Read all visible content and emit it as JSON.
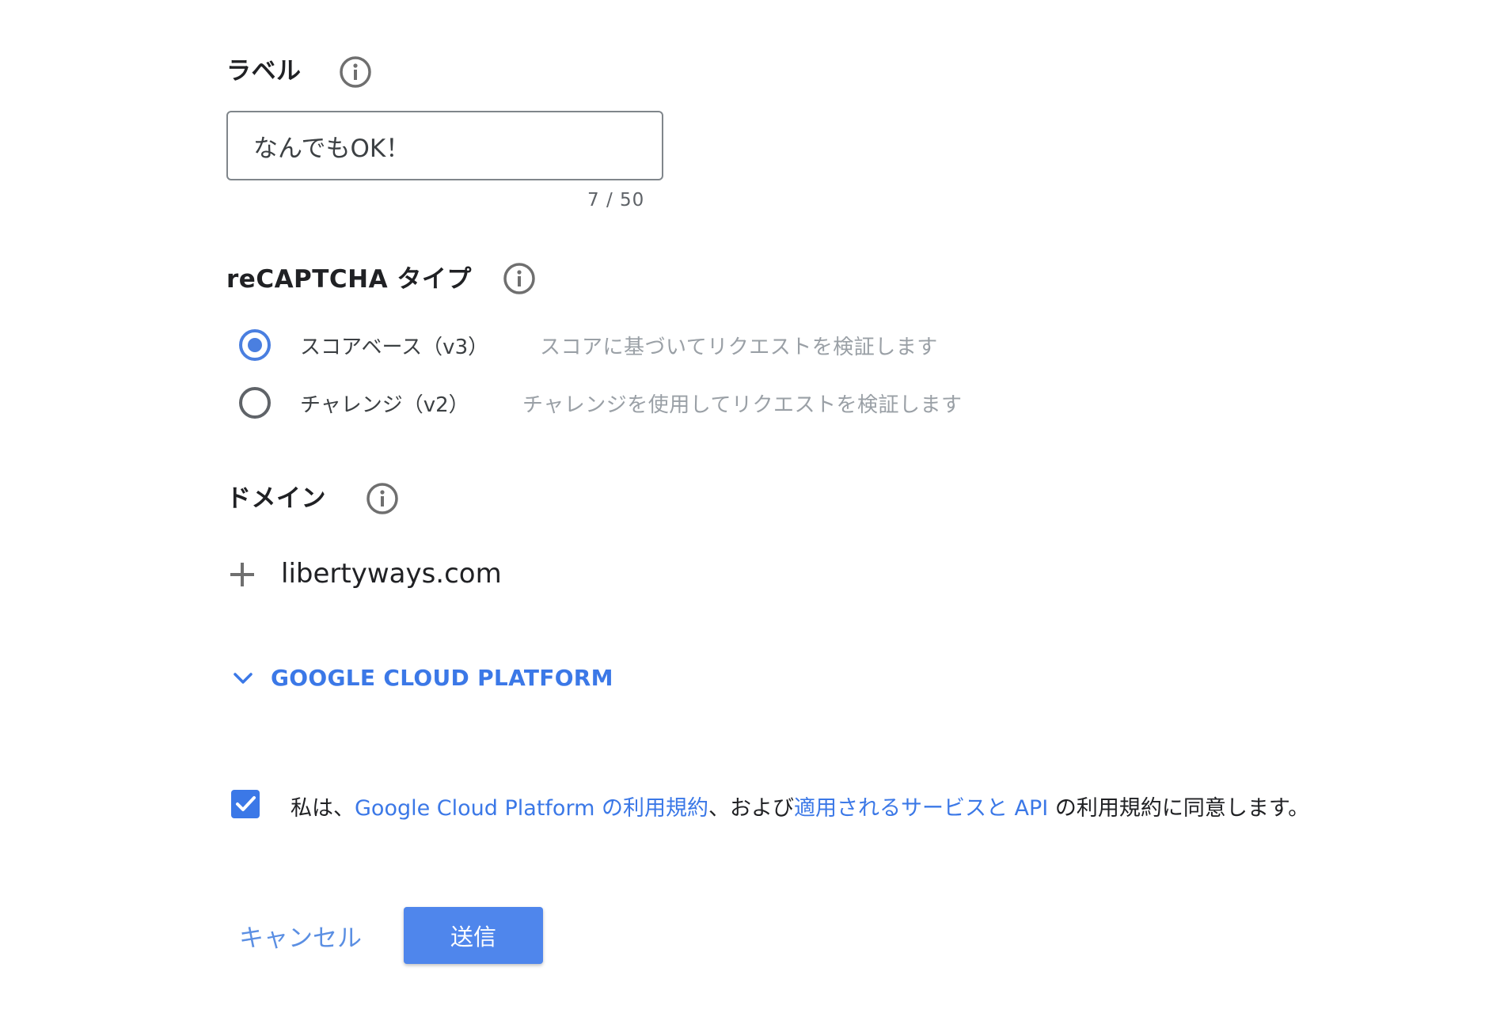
{
  "label_section": {
    "title": "ラベル",
    "input_value": "なんでもOK！",
    "counter": "7 / 50"
  },
  "type_section": {
    "title": "reCAPTCHA タイプ",
    "options": [
      {
        "label": "スコアベース（v3）",
        "description": "スコアに基づいてリクエストを検証します",
        "selected": true
      },
      {
        "label": "チャレンジ（v2）",
        "description": "チャレンジを使用してリクエストを検証します",
        "selected": false
      }
    ]
  },
  "domain_section": {
    "title": "ドメイン",
    "domain": "libertyways.com"
  },
  "gcp": {
    "label": "GOOGLE CLOUD PLATFORM"
  },
  "terms": {
    "checked": true,
    "prefix": "私は、",
    "link1": "Google Cloud Platform の利用規約",
    "middle": "、および",
    "link2": "適用されるサービスと API",
    "suffix": " の利用規約に同意します。"
  },
  "actions": {
    "cancel": "キャンセル",
    "submit": "送信"
  },
  "colors": {
    "accent": "#3b78e7",
    "button": "#4f86ec",
    "muted_text": "#9aa0a6"
  },
  "icons": {
    "info": "info-icon",
    "plus": "plus-icon",
    "chevron": "chevron-down-icon",
    "check": "check-icon"
  }
}
